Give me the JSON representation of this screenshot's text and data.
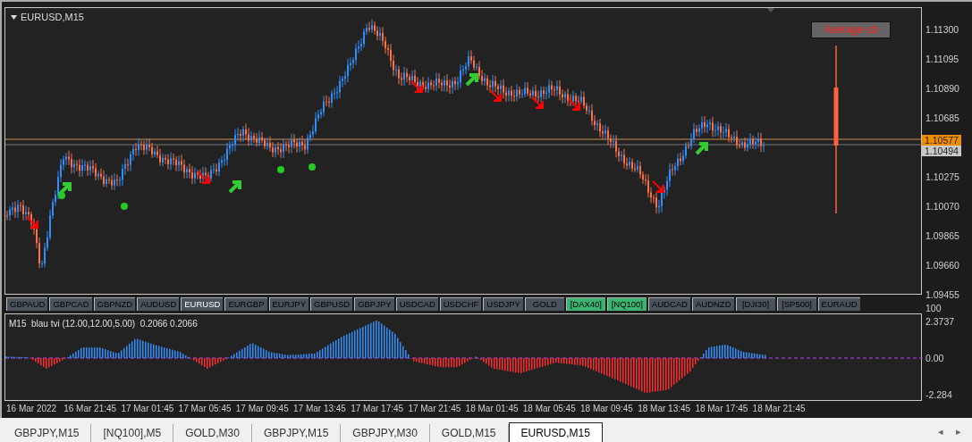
{
  "chart_window": {
    "title": "EURUSD,M15",
    "average_button": "Average cb"
  },
  "price_axis": {
    "ticks": [
      "1.11300",
      "1.11095",
      "1.10890",
      "1.10685",
      "1.10275",
      "1.10070",
      "1.09865",
      "1.09660",
      "1.09455"
    ],
    "bid_label": "1.10577",
    "ask_label": "1.10494"
  },
  "symbols": [
    {
      "label": "GBPAUD",
      "selected": false,
      "color": "#4a525c"
    },
    {
      "label": "GBPCAD",
      "selected": false,
      "color": "#4a525c"
    },
    {
      "label": "GBPNZD",
      "selected": false,
      "color": "#4a525c"
    },
    {
      "label": "AUDUSD",
      "selected": false,
      "color": "#4a525c"
    },
    {
      "label": "EURUSD",
      "selected": true,
      "color": "#4a525c"
    },
    {
      "label": "EURGBP",
      "selected": false,
      "color": "#4a525c"
    },
    {
      "label": "EURJPY",
      "selected": false,
      "color": "#4a525c"
    },
    {
      "label": "GBPUSD",
      "selected": false,
      "color": "#4a525c"
    },
    {
      "label": "GBPJPY",
      "selected": false,
      "color": "#4a525c"
    },
    {
      "label": "USDCAD",
      "selected": false,
      "color": "#4a525c"
    },
    {
      "label": "USDCHF",
      "selected": false,
      "color": "#4a525c"
    },
    {
      "label": "USDJPY",
      "selected": false,
      "color": "#4a525c"
    },
    {
      "label": "GOLD",
      "selected": false,
      "color": "#4a525c"
    },
    {
      "label": "[DAX40]",
      "selected": false,
      "color": "#3cb371"
    },
    {
      "label": "[NQ100]",
      "selected": false,
      "color": "#3cb371"
    },
    {
      "label": "AUDCAD",
      "selected": false,
      "color": "#4a525c"
    },
    {
      "label": "AUDNZD",
      "selected": false,
      "color": "#4a525c"
    },
    {
      "label": "[DJI30]",
      "selected": false,
      "color": "#4a525c"
    },
    {
      "label": "[SP500]",
      "selected": false,
      "color": "#4a525c"
    },
    {
      "label": "EURAUD",
      "selected": false,
      "color": "#4a525c"
    }
  ],
  "indicator": {
    "label": "M15  blau tvi (12.00,12.00,5.00)  0.2066 0.2066",
    "axis_labels": [
      "100",
      "2.3737",
      "0.00",
      "-2.284"
    ]
  },
  "time_axis": [
    "16 Mar 2022",
    "16 Mar 21:45",
    "17 Mar 01:45",
    "17 Mar 05:45",
    "17 Mar 09:45",
    "17 Mar 13:45",
    "17 Mar 17:45",
    "17 Mar 21:45",
    "18 Mar 01:45",
    "18 Mar 05:45",
    "18 Mar 09:45",
    "18 Mar 13:45",
    "18 Mar 17:45",
    "18 Mar 21:45"
  ],
  "tabs": [
    {
      "label": "GBPJPY,M15",
      "selected": false
    },
    {
      "label": "[NQ100],M5",
      "selected": false
    },
    {
      "label": "GOLD,M30",
      "selected": false
    },
    {
      "label": "GBPJPY,M15",
      "selected": false
    },
    {
      "label": "GBPJPY,M30",
      "selected": false
    },
    {
      "label": "GOLD,M15",
      "selected": false
    },
    {
      "label": "EURUSD,M15",
      "selected": true
    }
  ],
  "tab_scroll": [
    "◂",
    "▸"
  ]
}
